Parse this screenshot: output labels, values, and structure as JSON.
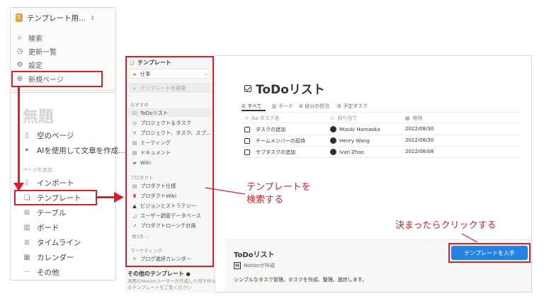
{
  "sidebar_top": {
    "workspace": "テンプレート用...",
    "items": [
      {
        "label": "検索",
        "icon": "search-icon"
      },
      {
        "label": "更新一覧",
        "icon": "clock-icon"
      },
      {
        "label": "設定",
        "icon": "gear-icon"
      },
      {
        "label": "新規ページ",
        "icon": "plus-circle-icon"
      }
    ]
  },
  "new_page_panel": {
    "title": "無題",
    "items": [
      {
        "label": "空のページ",
        "icon": "page-icon"
      },
      {
        "label": "AIを使用して文章を作成...",
        "icon": "ai-sparkle-icon"
      }
    ],
    "add_caption": "ページを追加",
    "add_items": [
      {
        "label": "インポート",
        "icon": "import-icon"
      },
      {
        "label": "テンプレート",
        "icon": "template-icon"
      },
      {
        "label": "テーブル",
        "icon": "table-icon"
      },
      {
        "label": "ボード",
        "icon": "board-icon"
      },
      {
        "label": "タイムライン",
        "icon": "timeline-icon"
      },
      {
        "label": "カレンダー",
        "icon": "calendar-icon"
      },
      {
        "label": "その他",
        "icon": "more-icon"
      }
    ]
  },
  "template_dialog": {
    "sidebar_title": "テンプレート",
    "category": "仕事",
    "search_placeholder": "テンプレートを検索",
    "sections": [
      {
        "title": "おすすめ",
        "items": [
          "ToDoリスト",
          "プロジェクト＆タスク",
          "プロジェクト、タスク、スプ...",
          "ミーティング",
          "ドキュメント",
          "Wiki"
        ]
      },
      {
        "title": "プロダクト",
        "items": [
          "プロダクト仕様",
          "プロダクトWiki",
          "ビジョンとストラテジー",
          "ユーザー調査データベース",
          "プロダクトローンチ計画"
        ]
      },
      {
        "title": "マーケティング",
        "items": [
          "ブログ進捗カレンダー"
        ]
      }
    ],
    "others_label": "他1件...",
    "other_templates_title": "その他のテンプレート",
    "other_templates_desc": "実際のNotionユーザーが作成した何千件ものテンプレートをご覧ください",
    "preview": {
      "title": "ToDoリスト",
      "views": [
        "すべて",
        "ボード",
        "自分の担当",
        "予定タスク"
      ],
      "columns": [
        "Aa タスク名",
        "割り当て",
        "期限"
      ],
      "rows": [
        {
          "task": "タスクの追加",
          "assignee": "Mizuki Hamaoka",
          "due": "2022/08/30"
        },
        {
          "task": "チームメンバーの招待",
          "assignee": "Henry Wang",
          "due": "2022/08/30"
        },
        {
          "task": "サブタスクの追加",
          "assignee": "Ivan Zhao",
          "due": "2022/08/08"
        }
      ]
    },
    "footer": {
      "title": "ToDoリスト",
      "author": "Notionが作成",
      "description": "シンプルなタスク管理。タスクを作成、整理、進捗します。",
      "get_button": "テンプレートを入手"
    }
  },
  "annotations": {
    "search_line1": "テンプレートを",
    "search_line2": "検索する",
    "click_note": "決まったらクリックする"
  },
  "colors": {
    "highlight": "#d6202b",
    "button": "#2383e2"
  }
}
